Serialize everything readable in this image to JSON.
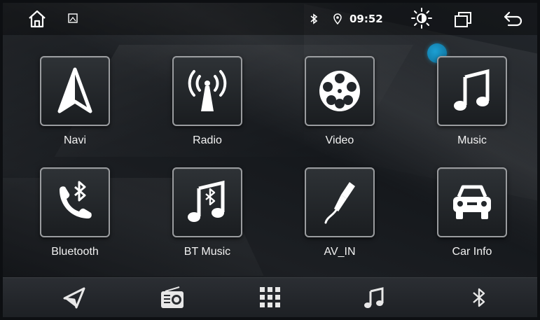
{
  "status_bar": {
    "time": "09:52",
    "icons": [
      "home-icon",
      "image-icon",
      "bluetooth-icon",
      "location-pin-icon",
      "brightness-icon",
      "recent-apps-icon",
      "back-arrow-icon"
    ]
  },
  "apps": [
    {
      "label": "Navi",
      "icon": "navigation-arrow-icon"
    },
    {
      "label": "Radio",
      "icon": "radio-antenna-icon"
    },
    {
      "label": "Video",
      "icon": "film-reel-icon"
    },
    {
      "label": "Music",
      "icon": "music-note-icon"
    },
    {
      "label": "Bluetooth",
      "icon": "bluetooth-phone-icon"
    },
    {
      "label": "BT Music",
      "icon": "bluetooth-music-icon"
    },
    {
      "label": "AV_IN",
      "icon": "av-cable-icon"
    },
    {
      "label": "Car Info",
      "icon": "car-icon"
    }
  ],
  "dock": {
    "icons": [
      "navigation-icon",
      "radio-icon",
      "app-grid-icon",
      "music-icon",
      "bluetooth-icon"
    ]
  },
  "colors": {
    "accent_dot": "#1c9fd3",
    "tile_border": "#9a9c9f",
    "background": "#15181c"
  }
}
